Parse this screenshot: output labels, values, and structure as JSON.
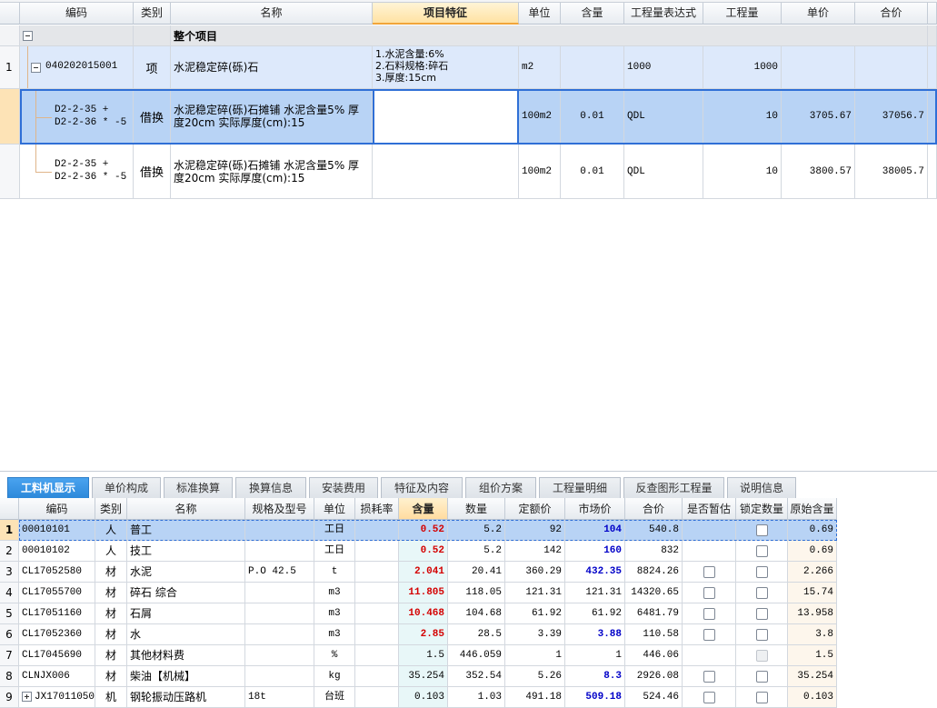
{
  "upper": {
    "columns": [
      "编码",
      "类别",
      "名称",
      "项目特征",
      "单位",
      "含量",
      "工程量表达式",
      "工程量",
      "单价",
      "合价"
    ],
    "group_label": "整个项目",
    "rows": [
      {
        "idx": "1",
        "code": "040202015001",
        "type": "项",
        "name": "水泥稳定碎(砾)石",
        "feature": [
          "1.水泥含量:6%",
          "2.石料规格:碎石",
          "3.厚度:15cm"
        ],
        "unit": "m2",
        "content": "",
        "expr": "1000",
        "qty": "1000",
        "price": "",
        "total": ""
      },
      {
        "idx": "",
        "code": "D2-2-35 +\nD2-2-36 * -5",
        "type": "借换",
        "name": "水泥稳定碎(砾)石摊铺 水泥含量5% 厚度20cm  实际厚度(cm):15",
        "feature": [],
        "unit": "100m2",
        "content": "0.01",
        "expr": "QDL",
        "qty": "10",
        "price": "3705.67",
        "total": "37056.7"
      },
      {
        "idx": "",
        "code": "D2-2-35 +\nD2-2-36 * -5",
        "type": "借换",
        "name": "水泥稳定碎(砾)石摊铺 水泥含量5% 厚度20cm  实际厚度(cm):15",
        "feature": [],
        "unit": "100m2",
        "content": "0.01",
        "expr": "QDL",
        "qty": "10",
        "price": "3800.57",
        "total": "38005.7"
      }
    ]
  },
  "tabs": [
    "工料机显示",
    "单价构成",
    "标准换算",
    "换算信息",
    "安装费用",
    "特征及内容",
    "组价方案",
    "工程量明细",
    "反查图形工程量",
    "说明信息"
  ],
  "lower": {
    "columns": [
      "编码",
      "类别",
      "名称",
      "规格及型号",
      "单位",
      "损耗率",
      "含量",
      "数量",
      "定额价",
      "市场价",
      "合价",
      "是否暂估",
      "锁定数量",
      "原始含量"
    ],
    "rows": [
      {
        "n": "1",
        "code": "00010101",
        "type": "人",
        "name": "普工",
        "spec": "",
        "unit": "工日",
        "loss": "",
        "content": "0.52",
        "qty": "5.2",
        "quota": "92",
        "market": "104",
        "total": "540.8",
        "est": "none",
        "lock": "box",
        "orig": "0.69"
      },
      {
        "n": "2",
        "code": "00010102",
        "type": "人",
        "name": "技工",
        "spec": "",
        "unit": "工日",
        "loss": "",
        "content": "0.52",
        "qty": "5.2",
        "quota": "142",
        "market": "160",
        "total": "832",
        "est": "none",
        "lock": "box",
        "orig": "0.69"
      },
      {
        "n": "3",
        "code": "CL17052580",
        "type": "材",
        "name": "水泥",
        "spec": "P.O 42.5",
        "unit": "t",
        "loss": "",
        "content": "2.041",
        "qty": "20.41",
        "quota": "360.29",
        "market": "432.35",
        "total": "8824.26",
        "est": "box",
        "lock": "box",
        "orig": "2.266"
      },
      {
        "n": "4",
        "code": "CL17055700",
        "type": "材",
        "name": "碎石 综合",
        "spec": "",
        "unit": "m3",
        "loss": "",
        "content": "11.805",
        "qty": "118.05",
        "quota": "121.31",
        "market": "121.31",
        "total": "14320.65",
        "est": "box",
        "lock": "box",
        "orig": "15.74"
      },
      {
        "n": "5",
        "code": "CL17051160",
        "type": "材",
        "name": "石屑",
        "spec": "",
        "unit": "m3",
        "loss": "",
        "content": "10.468",
        "qty": "104.68",
        "quota": "61.92",
        "market": "61.92",
        "total": "6481.79",
        "est": "box",
        "lock": "box",
        "orig": "13.958"
      },
      {
        "n": "6",
        "code": "CL17052360",
        "type": "材",
        "name": "水",
        "spec": "",
        "unit": "m3",
        "loss": "",
        "content": "2.85",
        "qty": "28.5",
        "quota": "3.39",
        "market": "3.88",
        "total": "110.58",
        "est": "box",
        "lock": "box",
        "orig": "3.8"
      },
      {
        "n": "7",
        "code": "CL17045690",
        "type": "材",
        "name": "其他材料费",
        "spec": "",
        "unit": "%",
        "loss": "",
        "content": "1.5",
        "qty": "446.059",
        "quota": "1",
        "market": "1",
        "total": "446.06",
        "est": "none",
        "lock": "dis",
        "orig": "1.5"
      },
      {
        "n": "8",
        "code": "CLNJX006",
        "type": "材",
        "name": "柴油【机械】",
        "spec": "",
        "unit": "kg",
        "loss": "",
        "content": "35.254",
        "qty": "352.54",
        "quota": "5.26",
        "market": "8.3",
        "total": "2926.08",
        "est": "box",
        "lock": "box",
        "orig": "35.254"
      },
      {
        "n": "9",
        "code": "JX17011050",
        "type": "机",
        "name": "钢轮振动压路机",
        "spec": "18t",
        "unit": "台班",
        "loss": "",
        "content": "0.103",
        "qty": "1.03",
        "quota": "491.18",
        "market": "509.18",
        "total": "524.46",
        "est": "box",
        "lock": "box",
        "orig": "0.103"
      }
    ],
    "red_content_rows": [
      0,
      1,
      2,
      3,
      4,
      5
    ],
    "blue_market_rows": [
      0,
      1,
      2,
      5,
      7,
      8
    ]
  },
  "colors": {
    "selected_row": "#b8d3f5",
    "group_row": "#e4e6e9",
    "data_row": "#dde9fb",
    "accent": "#2b87d9"
  }
}
